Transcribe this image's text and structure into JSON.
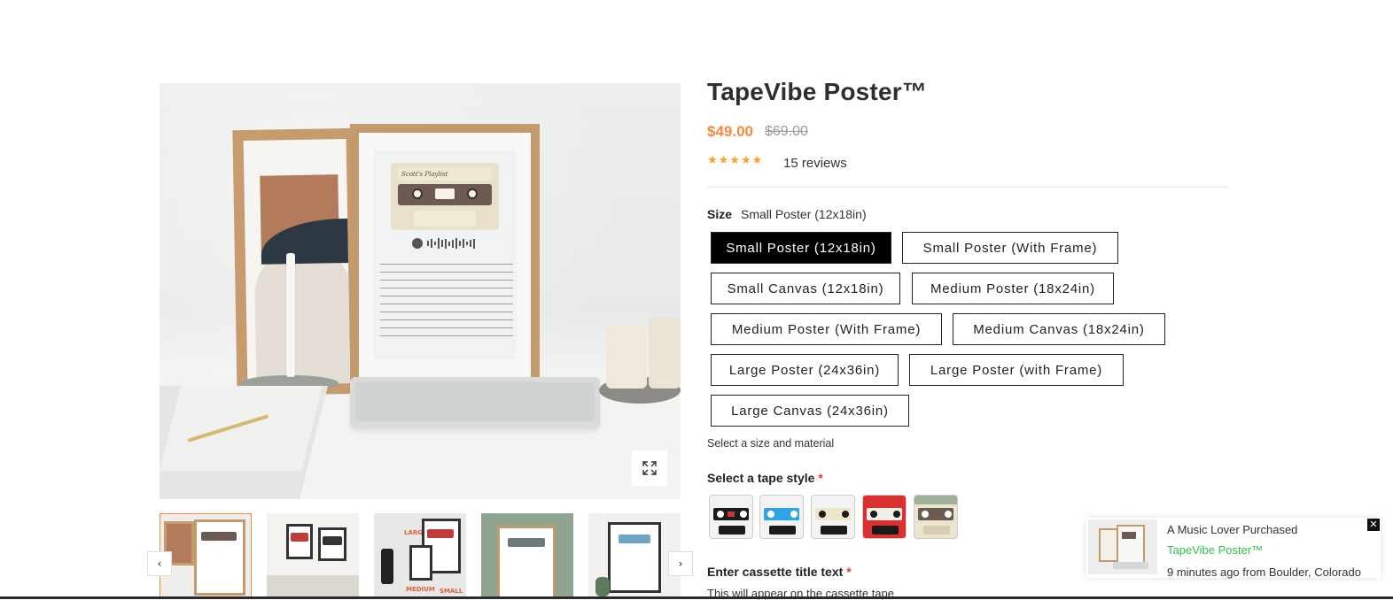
{
  "product": {
    "title": "TapeVibe Poster™",
    "price": "$49.00",
    "compare_price": "$69.00",
    "rating": 5,
    "stars": "★★★★★",
    "reviews": "15 reviews"
  },
  "gallery": {
    "main_image_icon": "framed-cassette-poster-photo",
    "expand_icon": "expand-icon",
    "poster_heading": "Scott's Playlist",
    "thumbs": [
      {
        "id": "thumb-1",
        "caption": ""
      },
      {
        "id": "thumb-2",
        "caption": ""
      },
      {
        "id": "thumb-3",
        "caption": "LARGE",
        "caption2": "MEDIUM",
        "caption3": "SMALL"
      },
      {
        "id": "thumb-4",
        "caption": ""
      },
      {
        "id": "thumb-5",
        "caption": ""
      }
    ],
    "prev_arrow": "‹",
    "next_arrow": "›"
  },
  "size": {
    "label": "Size",
    "selected_value": "Small Poster (12x18in)",
    "options": [
      "Small Poster (12x18in)",
      "Small Poster (With Frame)",
      "Small Canvas (12x18in)",
      "Medium Poster (18x24in)",
      "Medium Poster (With Frame)",
      "Medium Canvas (18x24in)",
      "Large Poster (24x36in)",
      "Large Poster (with Frame)",
      "Large Canvas (24x36in)"
    ],
    "helper": "Select a size and material"
  },
  "tape_style": {
    "label": "Select a tape style",
    "required_mark": "*",
    "swatches": [
      {
        "name": "black-red",
        "band": "#1b1b1b",
        "accent": "#ffffff"
      },
      {
        "name": "blue-black",
        "band": "#2ea3e6",
        "accent": "#ffffff"
      },
      {
        "name": "cream-black",
        "band": "#efe6c9",
        "accent": "#1b1b1b"
      },
      {
        "name": "red-black",
        "band": "#d93030",
        "accent": "#1b1b1b"
      },
      {
        "name": "cream-sage",
        "band": "#ede4cf",
        "accent": "#6a5a50"
      }
    ]
  },
  "cassette_text": {
    "label": "Enter cassette title text",
    "required_mark": "*",
    "helper": "This will appear on the cassette tape"
  },
  "popup": {
    "line1": "A Music Lover Purchased",
    "line2": "TapeVibe Poster™",
    "line3": "9 minutes ago from Boulder, Colorado",
    "close": "✕"
  },
  "colors": {
    "accent": "#f58a3c",
    "star": "#f5a623",
    "required": "#e03a3a",
    "popup_link": "#2fc14e"
  }
}
